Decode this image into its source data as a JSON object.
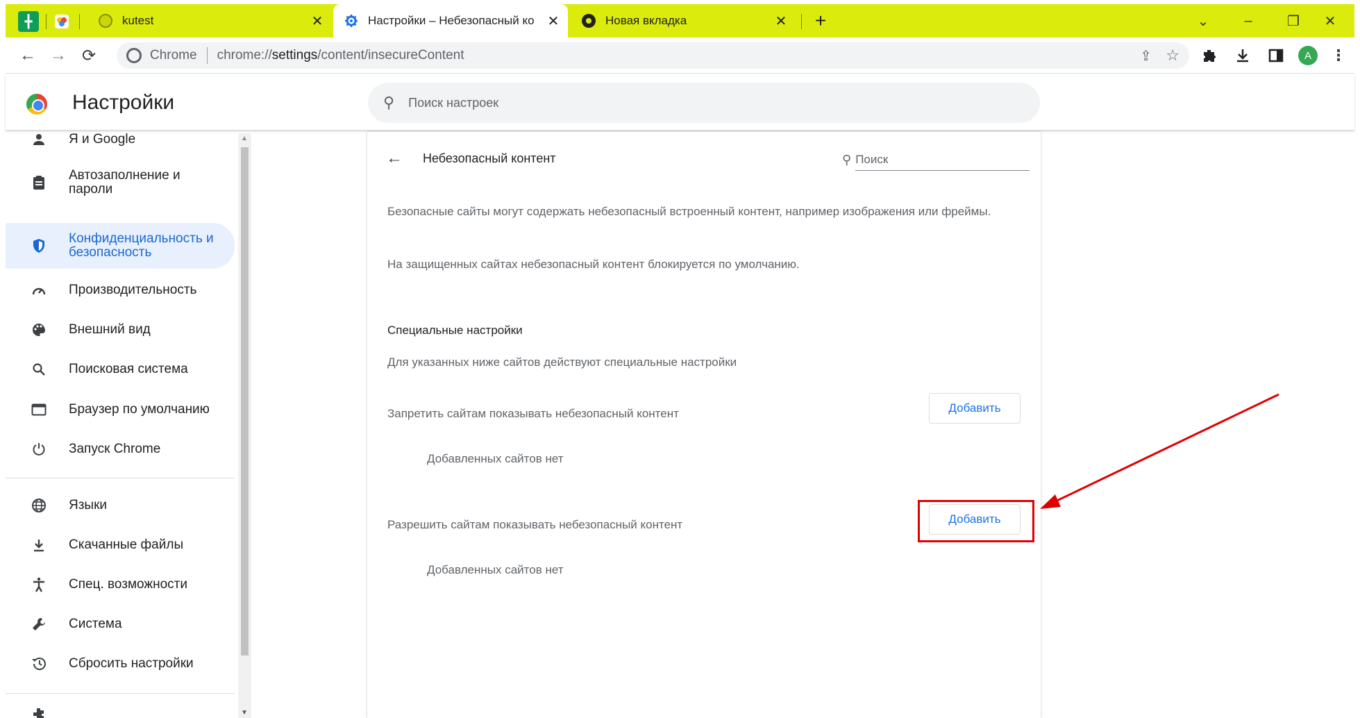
{
  "tabs": {
    "pinned": [
      {
        "icon": "sheets-icon",
        "color": "#0f9d58"
      },
      {
        "icon": "app-icon",
        "color": "#ea4335"
      }
    ],
    "items": [
      {
        "title": "kutest",
        "close": "✕"
      },
      {
        "title": "Настройки – Небезопасный ко",
        "close": "✕"
      },
      {
        "title": "Новая вкладка",
        "close": "✕"
      }
    ],
    "new_tab": "+",
    "window_controls": {
      "tab_search": "⌄",
      "minimize": "–",
      "restore": "❐",
      "close": "✕"
    }
  },
  "toolbar": {
    "back": "←",
    "forward": "→",
    "reload": "⟳",
    "site_label": "Chrome",
    "url_prefix": "chrome://",
    "url_host": "settings",
    "url_path": "/content/insecureContent",
    "icons": [
      "share-icon",
      "bookmark-star-icon",
      "extensions-icon",
      "download-icon",
      "side-panel-icon",
      "profile-avatar",
      "menu-icon"
    ],
    "avatar_letter": "A"
  },
  "header": {
    "title": "Настройки",
    "search_placeholder": "Поиск настроек"
  },
  "sidebar": {
    "items": [
      {
        "label": "Я и Google"
      },
      {
        "label": "Автозаполнение и пароли"
      },
      {
        "label": "Конфиденциальность и безопасность"
      },
      {
        "label": "Производительность"
      },
      {
        "label": "Внешний вид"
      },
      {
        "label": "Поисковая система"
      },
      {
        "label": "Браузер по умолчанию"
      },
      {
        "label": "Запуск Chrome"
      },
      {
        "label": "Языки"
      },
      {
        "label": "Скачанные файлы"
      },
      {
        "label": "Спец. возможности"
      },
      {
        "label": "Система"
      },
      {
        "label": "Сбросить настройки"
      }
    ]
  },
  "main": {
    "heading": "Небезопасный контент",
    "search_placeholder": "Поиск",
    "description_1": "Безопасные сайты могут содержать небезопасный встроенный контент, например изображения или фреймы.",
    "description_2": "На защищенных сайтах небезопасный контент блокируется по умолчанию.",
    "custom_title": "Специальные настройки",
    "custom_desc": "Для указанных ниже сайтов действуют специальные настройки",
    "block": {
      "label": "Запретить сайтам показывать небезопасный контент",
      "button": "Добавить",
      "empty": "Добавленных сайтов нет"
    },
    "allow": {
      "label": "Разрешить сайтам показывать небезопасный контент",
      "button": "Добавить",
      "empty": "Добавленных сайтов нет"
    }
  },
  "colors": {
    "tabstrip": "#dbec0c",
    "accent": "#1a73e8",
    "annotation": "#e00000"
  }
}
